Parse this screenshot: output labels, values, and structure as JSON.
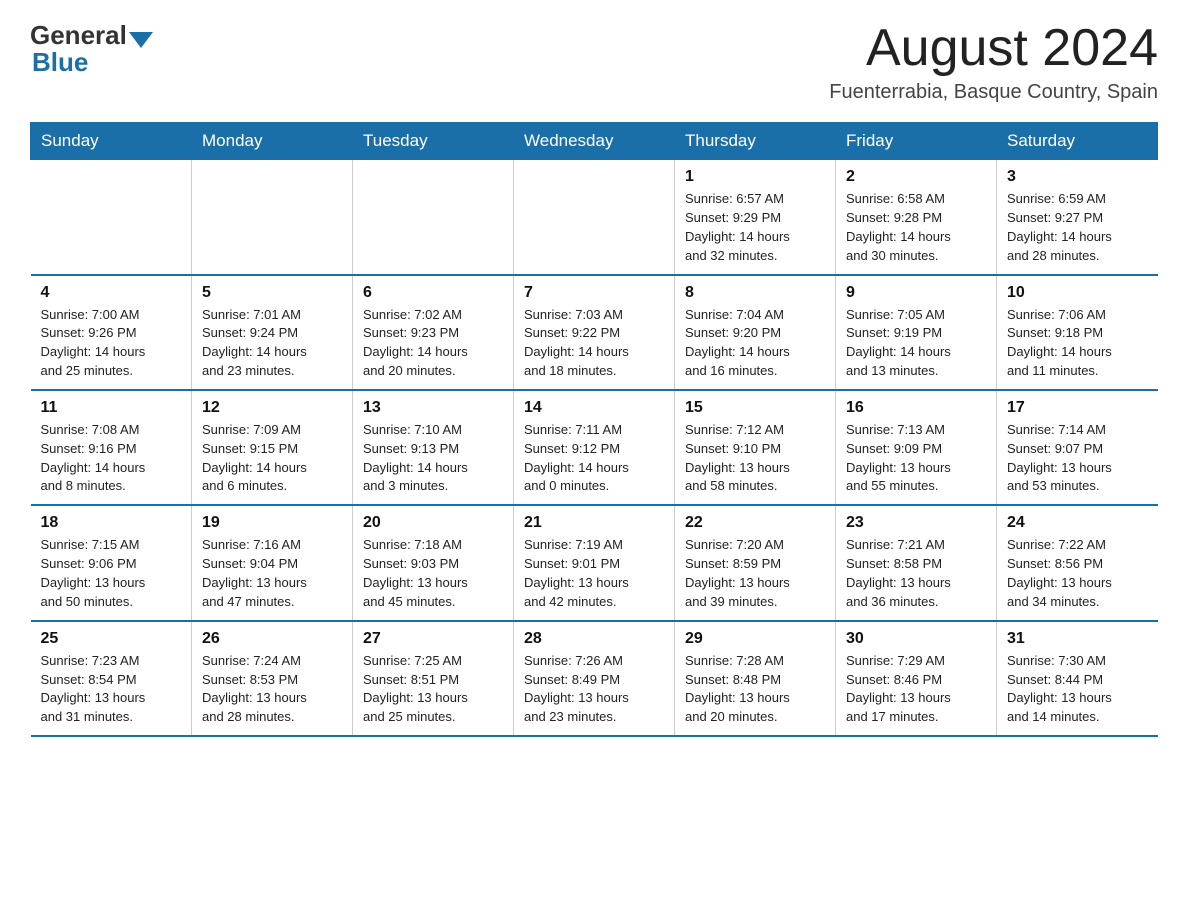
{
  "logo": {
    "general": "General",
    "blue": "Blue"
  },
  "title": "August 2024",
  "location": "Fuenterrabia, Basque Country, Spain",
  "days_header": [
    "Sunday",
    "Monday",
    "Tuesday",
    "Wednesday",
    "Thursday",
    "Friday",
    "Saturday"
  ],
  "weeks": [
    [
      {
        "num": "",
        "info": ""
      },
      {
        "num": "",
        "info": ""
      },
      {
        "num": "",
        "info": ""
      },
      {
        "num": "",
        "info": ""
      },
      {
        "num": "1",
        "info": "Sunrise: 6:57 AM\nSunset: 9:29 PM\nDaylight: 14 hours\nand 32 minutes."
      },
      {
        "num": "2",
        "info": "Sunrise: 6:58 AM\nSunset: 9:28 PM\nDaylight: 14 hours\nand 30 minutes."
      },
      {
        "num": "3",
        "info": "Sunrise: 6:59 AM\nSunset: 9:27 PM\nDaylight: 14 hours\nand 28 minutes."
      }
    ],
    [
      {
        "num": "4",
        "info": "Sunrise: 7:00 AM\nSunset: 9:26 PM\nDaylight: 14 hours\nand 25 minutes."
      },
      {
        "num": "5",
        "info": "Sunrise: 7:01 AM\nSunset: 9:24 PM\nDaylight: 14 hours\nand 23 minutes."
      },
      {
        "num": "6",
        "info": "Sunrise: 7:02 AM\nSunset: 9:23 PM\nDaylight: 14 hours\nand 20 minutes."
      },
      {
        "num": "7",
        "info": "Sunrise: 7:03 AM\nSunset: 9:22 PM\nDaylight: 14 hours\nand 18 minutes."
      },
      {
        "num": "8",
        "info": "Sunrise: 7:04 AM\nSunset: 9:20 PM\nDaylight: 14 hours\nand 16 minutes."
      },
      {
        "num": "9",
        "info": "Sunrise: 7:05 AM\nSunset: 9:19 PM\nDaylight: 14 hours\nand 13 minutes."
      },
      {
        "num": "10",
        "info": "Sunrise: 7:06 AM\nSunset: 9:18 PM\nDaylight: 14 hours\nand 11 minutes."
      }
    ],
    [
      {
        "num": "11",
        "info": "Sunrise: 7:08 AM\nSunset: 9:16 PM\nDaylight: 14 hours\nand 8 minutes."
      },
      {
        "num": "12",
        "info": "Sunrise: 7:09 AM\nSunset: 9:15 PM\nDaylight: 14 hours\nand 6 minutes."
      },
      {
        "num": "13",
        "info": "Sunrise: 7:10 AM\nSunset: 9:13 PM\nDaylight: 14 hours\nand 3 minutes."
      },
      {
        "num": "14",
        "info": "Sunrise: 7:11 AM\nSunset: 9:12 PM\nDaylight: 14 hours\nand 0 minutes."
      },
      {
        "num": "15",
        "info": "Sunrise: 7:12 AM\nSunset: 9:10 PM\nDaylight: 13 hours\nand 58 minutes."
      },
      {
        "num": "16",
        "info": "Sunrise: 7:13 AM\nSunset: 9:09 PM\nDaylight: 13 hours\nand 55 minutes."
      },
      {
        "num": "17",
        "info": "Sunrise: 7:14 AM\nSunset: 9:07 PM\nDaylight: 13 hours\nand 53 minutes."
      }
    ],
    [
      {
        "num": "18",
        "info": "Sunrise: 7:15 AM\nSunset: 9:06 PM\nDaylight: 13 hours\nand 50 minutes."
      },
      {
        "num": "19",
        "info": "Sunrise: 7:16 AM\nSunset: 9:04 PM\nDaylight: 13 hours\nand 47 minutes."
      },
      {
        "num": "20",
        "info": "Sunrise: 7:18 AM\nSunset: 9:03 PM\nDaylight: 13 hours\nand 45 minutes."
      },
      {
        "num": "21",
        "info": "Sunrise: 7:19 AM\nSunset: 9:01 PM\nDaylight: 13 hours\nand 42 minutes."
      },
      {
        "num": "22",
        "info": "Sunrise: 7:20 AM\nSunset: 8:59 PM\nDaylight: 13 hours\nand 39 minutes."
      },
      {
        "num": "23",
        "info": "Sunrise: 7:21 AM\nSunset: 8:58 PM\nDaylight: 13 hours\nand 36 minutes."
      },
      {
        "num": "24",
        "info": "Sunrise: 7:22 AM\nSunset: 8:56 PM\nDaylight: 13 hours\nand 34 minutes."
      }
    ],
    [
      {
        "num": "25",
        "info": "Sunrise: 7:23 AM\nSunset: 8:54 PM\nDaylight: 13 hours\nand 31 minutes."
      },
      {
        "num": "26",
        "info": "Sunrise: 7:24 AM\nSunset: 8:53 PM\nDaylight: 13 hours\nand 28 minutes."
      },
      {
        "num": "27",
        "info": "Sunrise: 7:25 AM\nSunset: 8:51 PM\nDaylight: 13 hours\nand 25 minutes."
      },
      {
        "num": "28",
        "info": "Sunrise: 7:26 AM\nSunset: 8:49 PM\nDaylight: 13 hours\nand 23 minutes."
      },
      {
        "num": "29",
        "info": "Sunrise: 7:28 AM\nSunset: 8:48 PM\nDaylight: 13 hours\nand 20 minutes."
      },
      {
        "num": "30",
        "info": "Sunrise: 7:29 AM\nSunset: 8:46 PM\nDaylight: 13 hours\nand 17 minutes."
      },
      {
        "num": "31",
        "info": "Sunrise: 7:30 AM\nSunset: 8:44 PM\nDaylight: 13 hours\nand 14 minutes."
      }
    ]
  ]
}
